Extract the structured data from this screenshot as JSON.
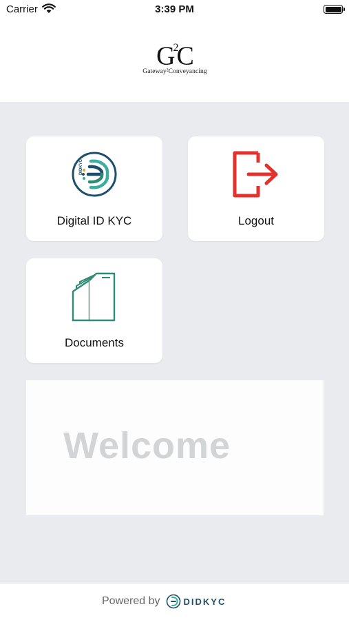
{
  "status_bar": {
    "carrier": "Carrier",
    "time": "3:39 PM"
  },
  "header": {
    "logo": {
      "mark_left": "G",
      "mark_sup": "2",
      "mark_right": "C",
      "tagline": "Gateway²Conveyancing"
    }
  },
  "tiles": [
    {
      "label": "Digital ID KYC",
      "icon": "didkyc-icon",
      "icon_text": "DIDKYC",
      "accent": "#1d4e6a"
    },
    {
      "label": "Logout",
      "icon": "logout-icon",
      "accent": "#e3312d"
    },
    {
      "label": "Documents",
      "icon": "documents-folder-icon",
      "accent": "#2f8a76"
    }
  ],
  "welcome": {
    "text": "Welcome"
  },
  "footer": {
    "powered_by": "Powered by",
    "brand": "DIDKYC"
  },
  "colors": {
    "background": "#e9ebee",
    "tile": "#ffffff",
    "logout_red": "#e3312d",
    "brand_navy": "#1d4e6a",
    "teal": "#2f8a76"
  }
}
